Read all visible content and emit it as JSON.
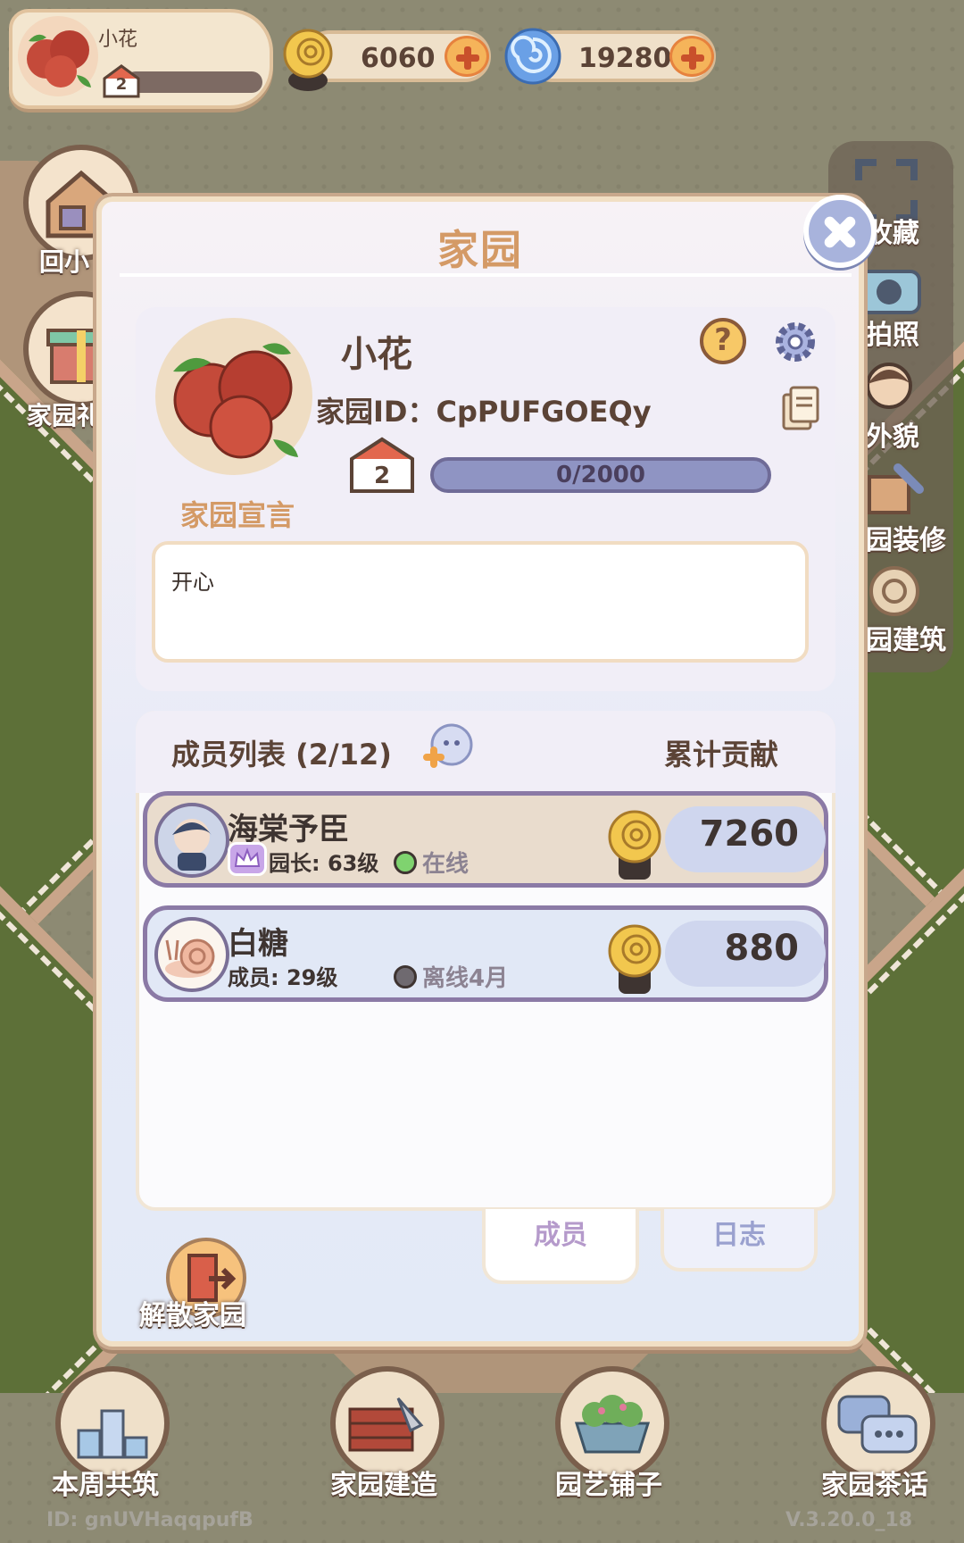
{
  "player": {
    "name": "小花",
    "level": "2"
  },
  "currencies": {
    "snail_coins": "6060",
    "spiral_gems": "19280"
  },
  "side_buttons": {
    "left": [
      "回小",
      "家园礼"
    ],
    "right": [
      "收藏",
      "拍照",
      "外貌",
      "园装修",
      "园建筑"
    ]
  },
  "dialog": {
    "title": "家园",
    "home_name": "小花",
    "home_id": "家园ID：CpPUFGOEQy",
    "level": "2",
    "exp": "0/2000",
    "declaration_label": "家园宣言",
    "declaration": "开心",
    "members_title": "成员列表 (2/12)",
    "contribution_title": "累计贡献",
    "members": [
      {
        "name": "海棠予臣",
        "role": "园长: 63级",
        "status": "在线",
        "status_color": "#7fd36f",
        "contribution": "7260"
      },
      {
        "name": "白糖",
        "role": "成员: 29级",
        "status": "离线4月",
        "status_color": "#6f6a70",
        "contribution": "880"
      }
    ],
    "tabs": [
      "成员",
      "日志"
    ],
    "active_tab": "成员",
    "dissolve_label": "解散家园"
  },
  "bottom_bar": [
    "本周共筑",
    "家园建造",
    "园艺铺子",
    "家园茶话"
  ],
  "footer": {
    "id": "ID: gnUVHaqqpufB",
    "version": "V.3.20.0_18"
  },
  "colors": {
    "accent": "#d49a66",
    "text_dark": "#5b4336",
    "row_border": "#8b7aa6"
  }
}
